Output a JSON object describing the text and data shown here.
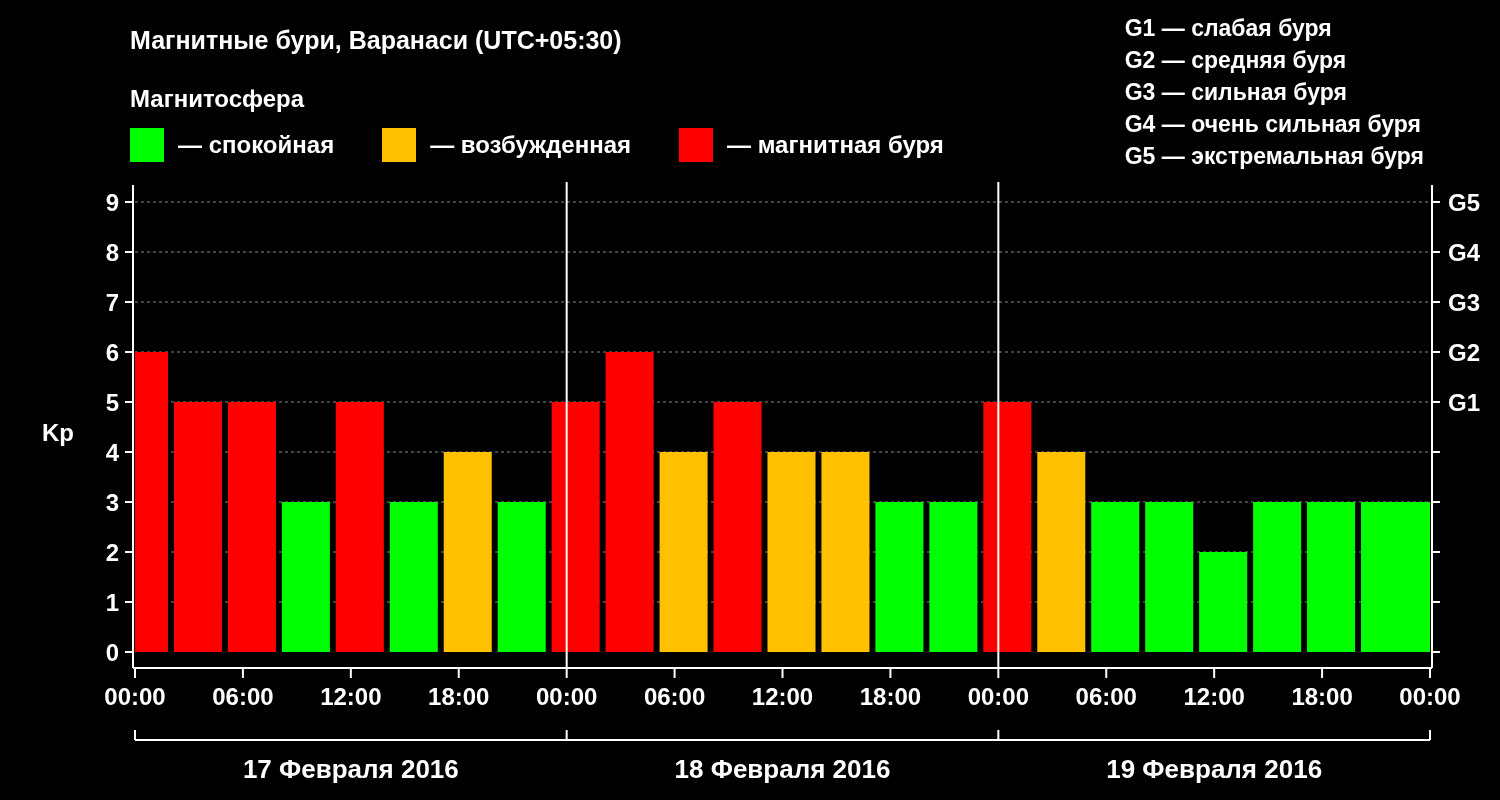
{
  "title": "Магнитные бури, Варанаси (UTC+05:30)",
  "legend": {
    "title": "Магнитосфера",
    "separator": "—"
  },
  "storm_scale": [
    "G1 — слабая буря",
    "G2 — средняя буря",
    "G3 — сильная буря",
    "G4 — очень сильная буря",
    "G5 — экстремальная буря"
  ],
  "chart_data": {
    "type": "bar",
    "ylabel": "Kp",
    "grid": true,
    "x": [
      "2016-02-17T00:30",
      "2016-02-17T03:30",
      "2016-02-17T06:30",
      "2016-02-17T09:30",
      "2016-02-17T12:30",
      "2016-02-17T15:30",
      "2016-02-17T18:30",
      "2016-02-17T21:30",
      "2016-02-18T00:30",
      "2016-02-18T03:30",
      "2016-02-18T06:30",
      "2016-02-18T09:30",
      "2016-02-18T12:30",
      "2016-02-18T15:30",
      "2016-02-18T18:30",
      "2016-02-18T21:30",
      "2016-02-19T00:30",
      "2016-02-19T03:30",
      "2016-02-19T06:30",
      "2016-02-19T09:30",
      "2016-02-19T12:30",
      "2016-02-19T15:30",
      "2016-02-19T18:30",
      "2016-02-19T21:30",
      "2016-02-20T00:00"
    ],
    "series": [
      {
        "name": "спокойная",
        "color": "#00ff00",
        "values": [
          null,
          null,
          null,
          3,
          null,
          3,
          null,
          3,
          null,
          null,
          null,
          null,
          null,
          null,
          3,
          3,
          null,
          null,
          3,
          3,
          2,
          3,
          3,
          3,
          3
        ]
      },
      {
        "name": "возбужденная",
        "color": "#ffc000",
        "values": [
          null,
          null,
          null,
          null,
          null,
          null,
          4,
          null,
          null,
          null,
          4,
          null,
          4,
          4,
          null,
          null,
          null,
          4,
          null,
          null,
          null,
          null,
          null,
          null,
          null
        ]
      },
      {
        "name": "магнитная буря",
        "color": "#ff0000",
        "values": [
          6,
          5,
          5,
          null,
          5,
          null,
          null,
          null,
          5,
          6,
          null,
          5,
          null,
          null,
          null,
          null,
          5,
          null,
          null,
          null,
          null,
          null,
          null,
          null,
          null
        ]
      }
    ],
    "xlim": [
      "2016-02-17T00:00",
      "2016-02-20T00:00"
    ],
    "ylim": [
      -0.32,
      9.34
    ],
    "xticks": [
      {
        "value": "2016-02-17T00:00",
        "label": "00:00"
      },
      {
        "value": "2016-02-17T06:00",
        "label": "06:00"
      },
      {
        "value": "2016-02-17T12:00",
        "label": "12:00"
      },
      {
        "value": "2016-02-17T18:00",
        "label": "18:00"
      },
      {
        "value": "2016-02-18T00:00",
        "label": "00:00"
      },
      {
        "value": "2016-02-18T06:00",
        "label": "06:00"
      },
      {
        "value": "2016-02-18T12:00",
        "label": "12:00"
      },
      {
        "value": "2016-02-18T18:00",
        "label": "18:00"
      },
      {
        "value": "2016-02-19T00:00",
        "label": "00:00"
      },
      {
        "value": "2016-02-19T06:00",
        "label": "06:00"
      },
      {
        "value": "2016-02-19T12:00",
        "label": "12:00"
      },
      {
        "value": "2016-02-19T18:00",
        "label": "18:00"
      },
      {
        "value": "2016-02-20T00:00",
        "label": "00:00"
      }
    ],
    "yticks": [
      0,
      1,
      2,
      3,
      4,
      5,
      6,
      7,
      8,
      9
    ]
  },
  "right_axis_labels": [
    "G5",
    "G4",
    "G3",
    "G2",
    "G1"
  ],
  "days": [
    "17 Февраля 2016",
    "18 Февраля 2016",
    "19 Февраля 2016"
  ]
}
